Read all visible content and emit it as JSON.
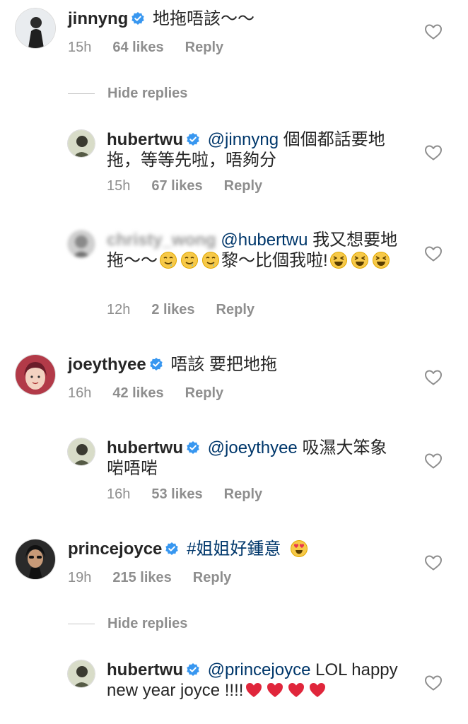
{
  "comments": [
    {
      "username": "jinnyng",
      "text": "地拖唔該～～",
      "time": "15h",
      "likes": "64 likes",
      "reply": "Reply"
    },
    {
      "username": "hubertwu",
      "mention": "@jinnyng",
      "text": "個個都話要地拖，等等先啦，唔夠分",
      "time": "15h",
      "likes": "67 likes",
      "reply": "Reply"
    },
    {
      "username": "christy_wong",
      "mention": "@hubertwu",
      "text_a": "我又想要地拖～～",
      "text_b": "黎～比個我啦!",
      "time": "12h",
      "likes": "2 likes",
      "reply": "Reply"
    },
    {
      "username": "joeythyee",
      "text": "唔該 要把地拖",
      "time": "16h",
      "likes": "42 likes",
      "reply": "Reply"
    },
    {
      "username": "hubertwu",
      "mention": "@joeythyee",
      "text": "吸濕大笨象啱唔啱",
      "time": "16h",
      "likes": "53 likes",
      "reply": "Reply"
    },
    {
      "username": "princejoyce",
      "text": "#姐姐好鍾意",
      "time": "19h",
      "likes": "215 likes",
      "reply": "Reply"
    },
    {
      "username": "hubertwu",
      "mention": "@princejoyce",
      "text": "LOL happy new year joyce !!!!"
    }
  ],
  "hide_replies": "Hide replies",
  "colors": {
    "verified": "#3897f0",
    "mention": "#00376b",
    "meta": "#8e8e8e",
    "text": "#262626"
  },
  "icons": {
    "like": "heart-outline-icon",
    "verified": "verified-badge-icon",
    "emoji_drool": "drooling-face-emoji",
    "emoji_laugh": "laughing-squint-emoji",
    "emoji_hearteyes": "heart-eyes-emoji",
    "emoji_heart": "red-heart-emoji"
  }
}
